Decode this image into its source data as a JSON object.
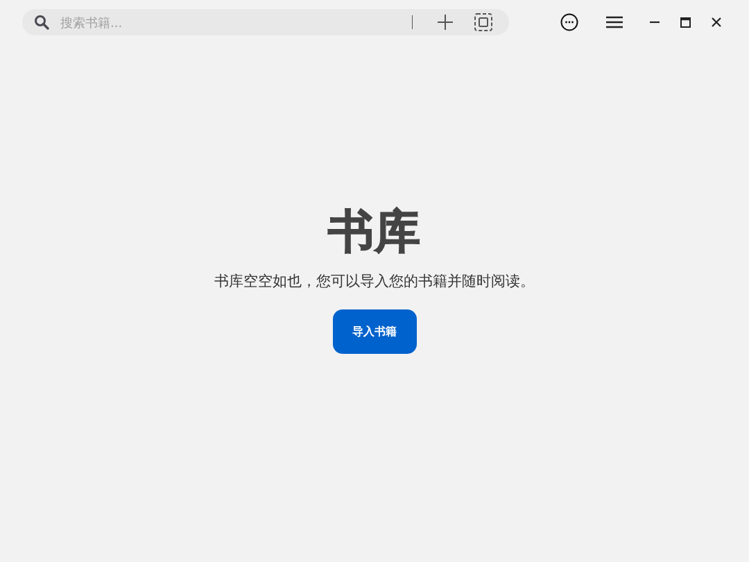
{
  "search": {
    "placeholder": "搜索书籍..."
  },
  "library": {
    "title": "书库",
    "message": "书库空空如也，您可以导入您的书籍并随时阅读。",
    "button": "导入书籍"
  }
}
